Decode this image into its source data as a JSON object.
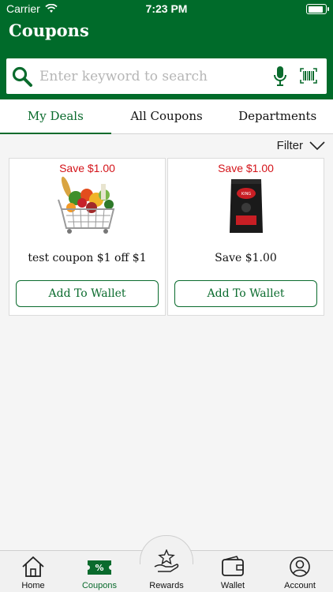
{
  "status": {
    "carrier": "Carrier",
    "time": "7:23 PM"
  },
  "header": {
    "title": "Coupons"
  },
  "search": {
    "placeholder": "Enter keyword to search"
  },
  "tabs": [
    {
      "label": "My Deals",
      "active": true
    },
    {
      "label": "All Coupons",
      "active": false
    },
    {
      "label": "Departments",
      "active": false
    }
  ],
  "filter": {
    "label": "Filter"
  },
  "coupons": [
    {
      "save": "Save $1.00",
      "title": "test coupon $1 off $1",
      "button": "Add To Wallet",
      "image": "grocery-basket"
    },
    {
      "save": "Save $1.00",
      "title": "Save $1.00",
      "button": "Add To Wallet",
      "image": "charcoal-bag"
    }
  ],
  "nav": [
    {
      "label": "Home",
      "icon": "home-icon"
    },
    {
      "label": "Coupons",
      "icon": "coupon-icon",
      "active": true
    },
    {
      "label": "Rewards",
      "icon": "rewards-icon"
    },
    {
      "label": "Wallet",
      "icon": "wallet-icon"
    },
    {
      "label": "Account",
      "icon": "account-icon"
    }
  ],
  "colors": {
    "brand": "#006b2a",
    "accent": "#0a6b2d",
    "save": "#d4141a"
  }
}
